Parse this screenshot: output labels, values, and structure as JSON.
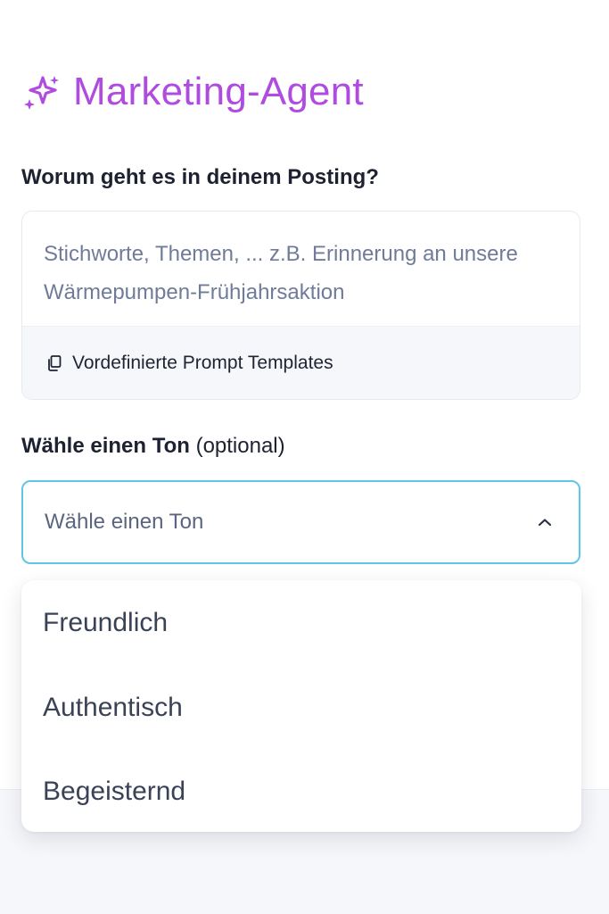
{
  "header": {
    "title": "Marketing-Agent",
    "icon": "sparkles-icon",
    "accent_color": "#b04be0"
  },
  "topic": {
    "label": "Worum geht es in deinem Posting?",
    "placeholder": "Stichworte, Themen, ... z.B. Erinnerung an unsere Wärmepumpen-Frühjahrsaktion",
    "value": "",
    "templates_label": "Vordefinierte Prompt Templates",
    "templates_icon": "copy-document-icon"
  },
  "tone": {
    "label_main": "Wähle einen Ton",
    "label_optional": "(optional)",
    "select_placeholder": "Wähle einen Ton",
    "expanded": true,
    "focus_color": "#5fc6e4",
    "options": [
      {
        "label": "Freundlich"
      },
      {
        "label": "Authentisch"
      },
      {
        "label": "Begeisternd"
      }
    ]
  }
}
